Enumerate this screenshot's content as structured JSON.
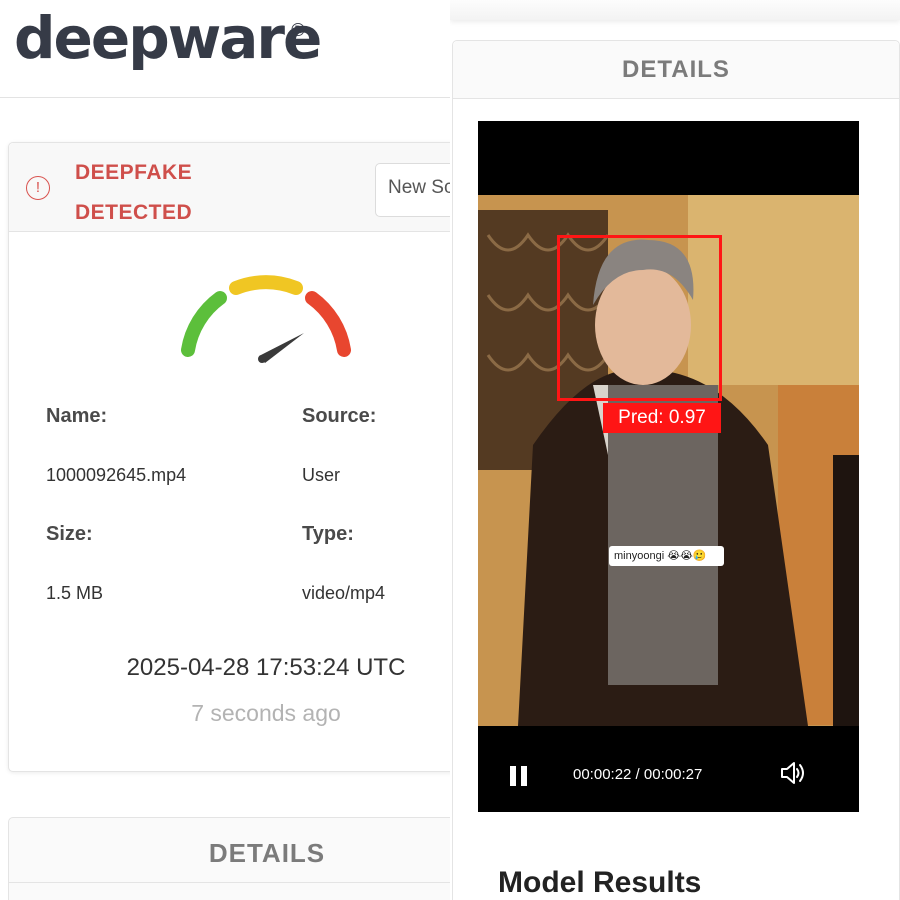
{
  "brand": {
    "logo_text": "deepware",
    "registered_mark": "®"
  },
  "result": {
    "status_line1": "DEEPFAKE",
    "status_line2": "DETECTED",
    "alert_icon": "exclamation-circle-icon",
    "new_scan_label": "New Scan"
  },
  "gauge": {
    "level": "high",
    "colors": [
      "#5cbf3b",
      "#f0c623",
      "#e8462f"
    ]
  },
  "file": {
    "name_label": "Name:",
    "name_value": "1000092645.mp4",
    "source_label": "Source:",
    "source_value": "User",
    "size_label": "Size:",
    "size_value": "1.5 MB",
    "type_label": "Type:",
    "type_value": "video/mp4"
  },
  "timestamp": "2025-04-28 17:53:24 UTC",
  "relative_time": "7 seconds ago",
  "details_heading": "DETAILS",
  "video": {
    "prediction_label": "Pred: 0.97",
    "overlay_caption": "minyoongi 😭😭🥲",
    "current_time": "00:00:22",
    "duration": "00:00:27",
    "timecode_separator": " / ",
    "play_state_icon": "pause-icon",
    "volume_icon": "volume-icon"
  },
  "model_results_heading": "Model Results",
  "colors": {
    "alert_red": "#cf4f4b",
    "box_red": "#ff1515",
    "logo": "#363b47"
  }
}
